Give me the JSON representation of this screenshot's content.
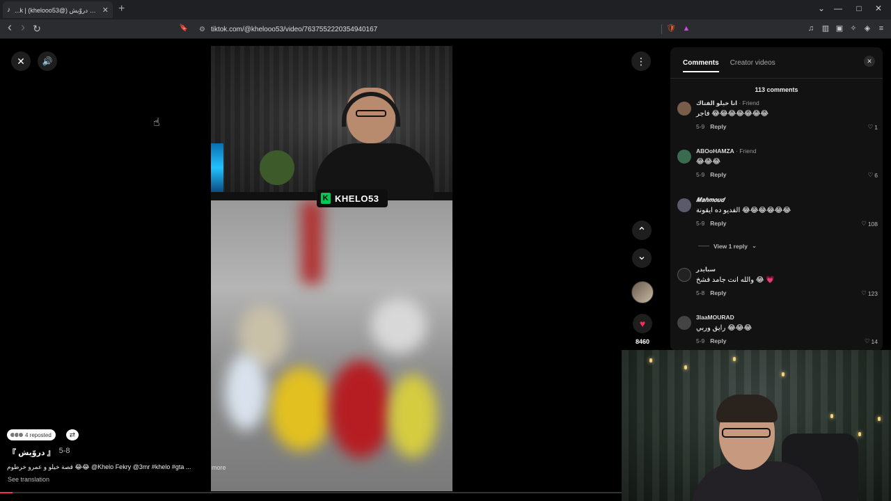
{
  "browser": {
    "tab_title": "...k | (khelooo53@) دروّيش 『 』",
    "url": "tiktok.com/@khelooo53/video/7637552220354940167"
  },
  "icons": {
    "close": "✕",
    "volume": "🔊",
    "more": "⋮",
    "up": "⌃",
    "down": "⌄",
    "heart": "♥",
    "tab_close": "✕",
    "new_tab": "+",
    "back": "‹",
    "forward": "›",
    "reload": "↻",
    "bookmark": "🔖",
    "minimize": "—",
    "maximize": "□",
    "window_close": "✕",
    "chevron": "⌄"
  },
  "video": {
    "streamer_tag": "KHELO53",
    "streamer_tag_letter": "K"
  },
  "sidebar_right": {
    "like_count": "8460"
  },
  "post": {
    "reposted": "4 reposted",
    "author": "『 دروّيش 』",
    "date": "5-8",
    "description": "قصة خيلو و عمرو خرطوم 😂😂 @Khelo Fekry @3mr #khelo #gta ...",
    "more": "more",
    "see_translation": "See translation"
  },
  "panel": {
    "tab_comments": "Comments",
    "tab_creator": "Creator videos",
    "count": "113 comments",
    "view_replies": "View 1 reply",
    "comments": [
      {
        "user": "انا خيلو الفتاك",
        "friend": " · Friend",
        "text": "فاجر 😂😂😂😂😂😂😂",
        "date": "5-9",
        "reply": "Reply",
        "likes": "1",
        "color": "#7a5c4a"
      },
      {
        "user": "ABOoHAMZA",
        "friend": " · Friend",
        "text": "😂😂😂",
        "date": "5-9",
        "reply": "Reply",
        "likes": "6",
        "color": "#3a6b4f"
      },
      {
        "user": "𝑴𝒂𝒉𝒎𝒐𝒖𝒅",
        "friend": "",
        "text": "الفديو ده ايقونة 😂😂😂😂😂😂",
        "date": "5-9",
        "reply": "Reply",
        "likes": "108",
        "color": "#5a5a6a"
      },
      {
        "user": "سبايدر",
        "friend": "",
        "text": "والله انت جامد فشخ 😂 💗",
        "date": "5-8",
        "reply": "Reply",
        "likes": "123",
        "color": "#222"
      },
      {
        "user": "3laaMOURAD",
        "friend": "",
        "text": "رايق وربي 😂😂😂",
        "date": "5-9",
        "reply": "Reply",
        "likes": "14",
        "color": "#444"
      }
    ]
  }
}
